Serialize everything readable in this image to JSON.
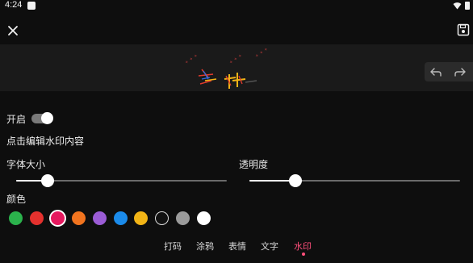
{
  "status": {
    "time": "4:24"
  },
  "toolbar": {
    "close_icon": "close-icon",
    "save_icon": "save-icon"
  },
  "preview": {
    "undo_icon": "undo-icon",
    "redo_icon": "redo-icon"
  },
  "watermark": {
    "enabled_label": "开启",
    "enabled": true,
    "edit_label": "点击编辑水印内容",
    "font_size_label": "字体大小",
    "font_size_level": 0.15,
    "opacity_label": "透明度",
    "opacity_level": 0.22,
    "color_label": "颜色",
    "colors": [
      {
        "hex": "#2bb24c",
        "selected": false
      },
      {
        "hex": "#e4312e",
        "selected": false
      },
      {
        "hex": "#e6195f",
        "selected": true
      },
      {
        "hex": "#f1741f",
        "selected": false
      },
      {
        "hex": "#9b5cd5",
        "selected": false
      },
      {
        "hex": "#1b8bea",
        "selected": false
      },
      {
        "hex": "#f2b416",
        "selected": false
      },
      {
        "hex": "#111111",
        "selected": false
      },
      {
        "hex": "#9b9b9b",
        "selected": false
      },
      {
        "hex": "#ffffff",
        "selected": false
      }
    ]
  },
  "tabs": [
    {
      "label": "打码",
      "active": false
    },
    {
      "label": "涂鸦",
      "active": false
    },
    {
      "label": "表情",
      "active": false
    },
    {
      "label": "文字",
      "active": false
    },
    {
      "label": "水印",
      "active": true
    }
  ],
  "accent_color": "#ff4f7b"
}
